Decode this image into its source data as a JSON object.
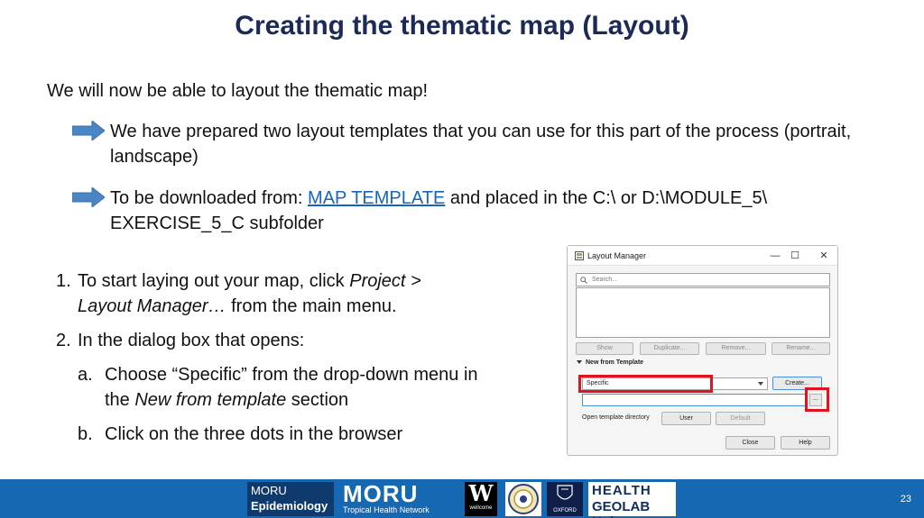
{
  "slide": {
    "title": "Creating the thematic map (Layout)",
    "intro": "We will now be able to layout the thematic map!",
    "bullet1": "We have prepared two layout templates that you can use for this part of the process (portrait, landscape)",
    "bullet2_pre": "To be downloaded from: ",
    "bullet2_link": "MAP TEMPLATE",
    "bullet2_post": " and placed in the C:\\ or D:\\MODULE_5\\ EXERCISE_5_C subfolder",
    "step1_num": "1.",
    "step1_a": "To start laying out your map, click ",
    "step1_b": "Project > Layout Manager…",
    "step1_c": " from the main menu.",
    "step2_num": "2.",
    "step2": "In the dialog box that opens:",
    "sub_a_num": "a.",
    "sub_a_1": "Choose “Specific” from the drop-down menu in the ",
    "sub_a_2": "New from template",
    "sub_a_3": " section",
    "sub_b_num": "b.",
    "sub_b": "Click on the three dots in the browser",
    "page_number": "23"
  },
  "dialog": {
    "title": "Layout Manager",
    "minimize": "—",
    "maximize": "☐",
    "close": "✕",
    "search_placeholder": "Search...",
    "btn_show": "Show",
    "btn_duplicate": "Duplicate...",
    "btn_remove": "Remove...",
    "btn_rename": "Rename...",
    "section_label": "New from Template",
    "combo_value": "Specific",
    "btn_create": "Create...",
    "btn_dots": "...",
    "open_dir_label": "Open template directory",
    "btn_user": "User",
    "btn_default": "Default",
    "btn_close": "Close",
    "btn_help": "Help"
  },
  "footer": {
    "moru_epi_1": "MORU",
    "moru_epi_2": "Epidemiology",
    "moru_main_1": "MORU",
    "moru_main_2": "Tropical Health Network",
    "wellcome_1": "W",
    "wellcome_2": "wellcome",
    "oxford": "OXFORD",
    "geolab_1": "HEALTH",
    "geolab_2": "GEOLAB Hub"
  },
  "colors": {
    "title": "#1b2a57",
    "link": "#1565c0",
    "arrow": "#4a86c5",
    "highlight": "#e0141e",
    "footer": "#1568b1"
  }
}
